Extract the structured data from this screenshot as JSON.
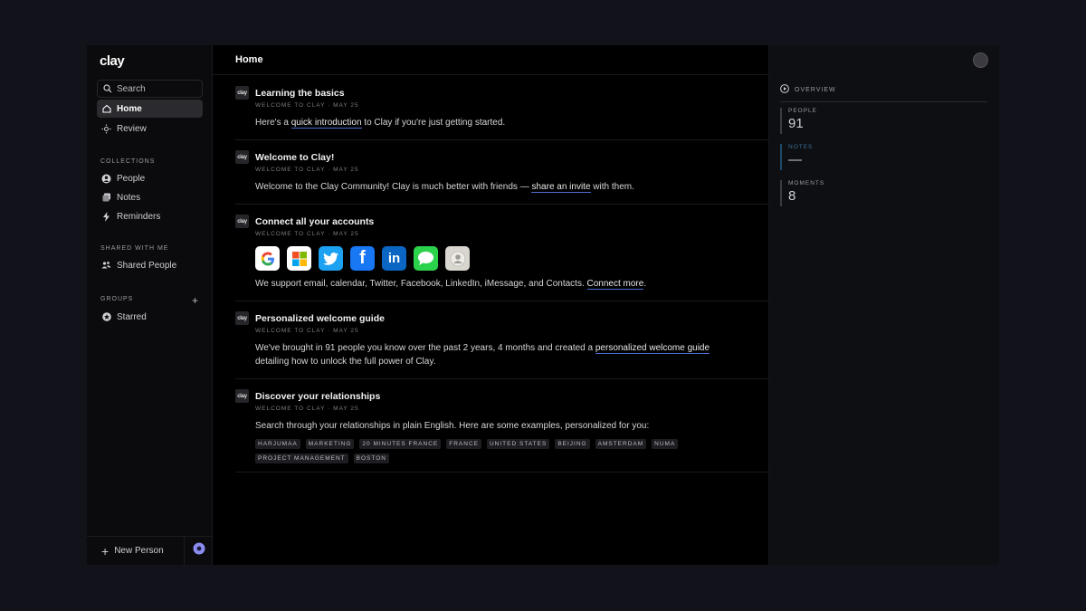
{
  "app": {
    "logo": "clay"
  },
  "sidebar": {
    "search_label": "Search",
    "nav": [
      {
        "label": "Home",
        "icon": "home-icon",
        "active": true
      },
      {
        "label": "Review",
        "icon": "sun-icon",
        "active": false
      }
    ],
    "collections_title": "COLLECTIONS",
    "collections": [
      {
        "label": "People",
        "icon": "person-circle-icon"
      },
      {
        "label": "Notes",
        "icon": "notes-icon"
      },
      {
        "label": "Reminders",
        "icon": "lightning-icon"
      }
    ],
    "shared_title": "SHARED WITH ME",
    "shared": [
      {
        "label": "Shared People",
        "icon": "shared-people-icon"
      }
    ],
    "groups_title": "GROUPS",
    "groups": [
      {
        "label": "Starred",
        "icon": "star-icon"
      }
    ],
    "new_person_label": "New Person"
  },
  "main": {
    "title": "Home",
    "cards": [
      {
        "badge": "clay",
        "title": "Learning the basics",
        "meta": "WELCOME TO CLAY · MAY 25",
        "body_pre": "Here's a ",
        "body_link": "quick introduction",
        "body_post": " to Clay if you're just getting started."
      },
      {
        "badge": "clay",
        "title": "Welcome to Clay!",
        "meta": "WELCOME TO CLAY · MAY 25",
        "body_pre": "Welcome to the Clay Community! Clay is much better with friends — ",
        "body_link": "share an invite",
        "body_post": " with them."
      },
      {
        "badge": "clay",
        "title": "Connect all your accounts",
        "meta": "WELCOME TO CLAY · MAY 25",
        "apps": [
          {
            "name": "google-icon",
            "glyph": "G",
            "bg": "#ffffff",
            "fg": "#4285f4"
          },
          {
            "name": "microsoft-icon",
            "glyph": "",
            "bg": "#ffffff",
            "fg": "#000"
          },
          {
            "name": "twitter-icon",
            "glyph": "🐦",
            "bg": "#1da1f2",
            "fg": "#fff"
          },
          {
            "name": "facebook-icon",
            "glyph": "f",
            "bg": "#1877f2",
            "fg": "#fff"
          },
          {
            "name": "linkedin-icon",
            "glyph": "in",
            "bg": "#0a66c2",
            "fg": "#fff"
          },
          {
            "name": "imessage-icon",
            "glyph": "💬",
            "bg": "#2bd24c",
            "fg": "#fff"
          },
          {
            "name": "contacts-icon",
            "glyph": "👤",
            "bg": "#d9d6cf",
            "fg": "#888"
          }
        ],
        "body_pre": "We support email, calendar, Twitter, Facebook, LinkedIn, iMessage, and Contacts. ",
        "body_link": "Connect more",
        "body_post": "."
      },
      {
        "badge": "clay",
        "title": "Personalized welcome guide",
        "meta": "WELCOME TO CLAY · MAY 25",
        "body_pre": "We've brought in 91 people you know over the past 2 years, 4 months and created a ",
        "body_link": "personalized welcome guide",
        "body_line2": "detailing how to unlock the full power of Clay."
      },
      {
        "badge": "clay",
        "title": "Discover your relationships",
        "meta": "WELCOME TO CLAY · MAY 25",
        "body": "Search through your relationships in plain English. Here are some examples, personalized for you:",
        "tags": [
          "HARJUMAA",
          "MARKETING",
          "20 MINUTES FRANCE",
          "FRANCE",
          "UNITED STATES",
          "BEIJING",
          "AMSTERDAM",
          "NUMA",
          "PROJECT MANAGEMENT",
          "BOSTON"
        ]
      }
    ]
  },
  "overview": {
    "title": "OVERVIEW",
    "stats": [
      {
        "label": "PEOPLE",
        "value": "91"
      },
      {
        "label": "NOTES",
        "value": "—"
      },
      {
        "label": "MOMENTS",
        "value": "8"
      }
    ]
  }
}
